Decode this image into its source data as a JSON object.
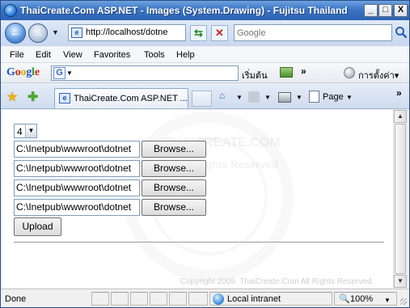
{
  "window": {
    "title": "ThaiCreate.Com ASP.NET - Images (System.Drawing) - Fujitsu Thailand",
    "minimize_label": "_",
    "maximize_label": "□",
    "close_label": "X"
  },
  "address_bar": {
    "back_label": "←",
    "forward_label": "→",
    "url": "http://localhost/dotne",
    "search_placeholder": "Google"
  },
  "menu": {
    "items": [
      "File",
      "Edit",
      "View",
      "Favorites",
      "Tools",
      "Help"
    ]
  },
  "google_toolbar": {
    "logo": "Google",
    "search_button": "เริ่มต้น",
    "more": "»",
    "settings_label": "การตั้งค่า▾"
  },
  "tab_bar": {
    "tab_label": "ThaiCreate.Com ASP.NET ...",
    "page_label": "Page",
    "more": "»"
  },
  "page": {
    "select_value": "4",
    "file_inputs": [
      {
        "path": "C:\\Inetpub\\wwwroot\\dotnet",
        "button": "Browse..."
      },
      {
        "path": "C:\\Inetpub\\wwwroot\\dotnet",
        "button": "Browse..."
      },
      {
        "path": "C:\\Inetpub\\wwwroot\\dotnet",
        "button": "Browse..."
      },
      {
        "path": "C:\\Inetpub\\wwwroot\\dotnet",
        "button": "Browse..."
      }
    ],
    "upload_label": "Upload",
    "copyright": "Copyright 2009. ThaiCreate.Com  All Rights Reserved.",
    "watermark_line1": "THAICREATE.COM",
    "watermark_line2": "All Rights Reserved"
  },
  "status_bar": {
    "status": "Done",
    "zone": "Local intranet",
    "zoom": "100%"
  },
  "colors": {
    "title_bar": "#3a74c4",
    "content_bg": "#ffffff"
  }
}
